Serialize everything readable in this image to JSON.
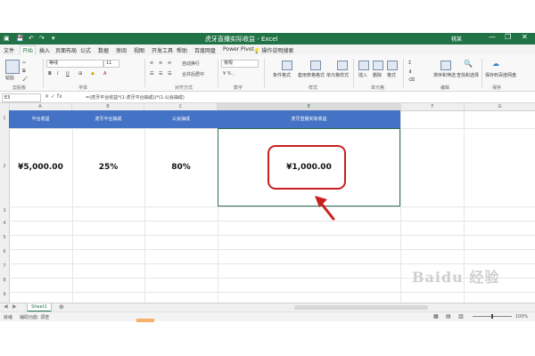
{
  "window": {
    "title": "虎牙直播实际收益 - Excel",
    "user": "桃某",
    "minimize": "—",
    "restore": "❐",
    "close": "✕"
  },
  "tabs": [
    "文件",
    "开始",
    "插入",
    "页面布局",
    "公式",
    "数据",
    "审阅",
    "视图",
    "开发工具",
    "帮助",
    "百度网盘",
    "Power Pivot",
    "操作说明搜索"
  ],
  "ribbon": {
    "font_name": "等线",
    "font_size": "11",
    "number_format": "常规",
    "wrap": "自动换行",
    "merge": "合并后居中",
    "groups": [
      "剪贴板",
      "字体",
      "对齐方式",
      "数字",
      "样式",
      "单元格",
      "编辑",
      "保存"
    ],
    "buttons": [
      "粘贴",
      "条件格式",
      "套用表格格式",
      "单元格样式",
      "插入",
      "删除",
      "格式",
      "排序和筛选",
      "查找和选择",
      "保存到百度网盘"
    ]
  },
  "formula_bar": {
    "name_box": "E3",
    "formula": "=(虎牙平台收益*(1-虎牙平台抽成))*(1-公会抽成)"
  },
  "sheet": {
    "columns": [
      "A",
      "B",
      "C",
      "D",
      "E",
      "F",
      "G"
    ],
    "rows": [
      "1",
      "2",
      "3",
      "4",
      "5",
      "6",
      "7",
      "8",
      "9",
      "10",
      "11",
      "12",
      "13"
    ],
    "headers": [
      "平台收益",
      "虎牙平台抽成",
      "公会抽成",
      "虎牙直播实际收益"
    ],
    "values": [
      "¥5,000.00",
      "25%",
      "80%",
      "¥1,000.00"
    ]
  },
  "sheet_tabs": {
    "active": "Sheet1",
    "add": "⊕"
  },
  "status": {
    "ready": "就绪",
    "accessibility": "辅助功能: 调查",
    "zoom": "100%"
  },
  "watermark": "Baidu 经验",
  "colors": {
    "excel_green": "#217346",
    "header_blue": "#4472c4",
    "highlight_red": "#c8201e"
  }
}
